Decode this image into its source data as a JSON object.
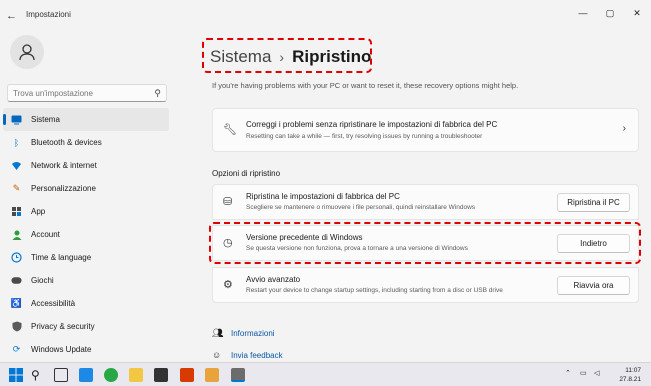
{
  "window": {
    "title": "Impostazioni",
    "back_icon": "back-arrow-icon",
    "controls": [
      "minimize-icon",
      "maximize-icon",
      "close-icon"
    ]
  },
  "search": {
    "placeholder": "Trova un'impostazione"
  },
  "sidebar": {
    "items": [
      {
        "label": "Sistema",
        "icon": "monitor-icon",
        "active": true,
        "color": "#0067c0"
      },
      {
        "label": "Bluetooth & devices",
        "icon": "bluetooth-icon",
        "color": "#0078d4"
      },
      {
        "label": "Network & internet",
        "icon": "wifi-icon",
        "color": "#0078d4"
      },
      {
        "label": "Personalizzazione",
        "icon": "brush-icon",
        "color": "#c85a00"
      },
      {
        "label": "App",
        "icon": "apps-icon",
        "color": "#4a4a4a"
      },
      {
        "label": "Account",
        "icon": "account-icon",
        "color": "#2e9b3f"
      },
      {
        "label": "Time & language",
        "icon": "globe-clock-icon",
        "color": "#0078d4"
      },
      {
        "label": "Giochi",
        "icon": "gamepad-icon",
        "color": "#4a4a4a"
      },
      {
        "label": "Accessibilità",
        "icon": "accessibility-icon",
        "color": "#0078d4"
      },
      {
        "label": "Privacy & security",
        "icon": "shield-icon",
        "color": "#5a5a5a"
      },
      {
        "label": "Windows Update",
        "icon": "update-icon",
        "color": "#0078d4"
      }
    ]
  },
  "main": {
    "breadcrumb_parent": "Sistema",
    "breadcrumb_current": "Ripristino",
    "intro": "If you're having problems with your PC or want to reset it, these recovery options might help.",
    "troubleshoot": {
      "title": "Correggi i problemi senza ripristinare le impostazioni di fabbrica del PC",
      "desc": "Resetting can take a while — first, try resolving issues by running a troubleshooter"
    },
    "section_label": "Opzioni di ripristino",
    "options": [
      {
        "title": "Ripristina le impostazioni di fabbrica del PC",
        "desc": "Scegliere se mantenere o rimuovere i file personali, quindi reinstallare Windows",
        "button": "Ripristina il PC",
        "icon": "reset-pc-icon"
      },
      {
        "title": "Versione precedente di Windows",
        "desc": "Se questa versione non funziona, prova a tornare a una versione di Windows",
        "button": "Indietro",
        "icon": "history-icon"
      },
      {
        "title": "Avvio avanzato",
        "desc": "Restart your device to change startup settings, including starting from a disc or USB drive",
        "button": "Riavvia ora",
        "icon": "advanced-startup-icon"
      }
    ],
    "links": [
      {
        "label": "Informazioni",
        "icon": "info-people-icon"
      },
      {
        "label": "Invia feedback",
        "icon": "feedback-icon"
      }
    ]
  },
  "taskbar": {
    "time": "11:07",
    "date": "27.8.21",
    "highlight_color": "#e00000"
  }
}
